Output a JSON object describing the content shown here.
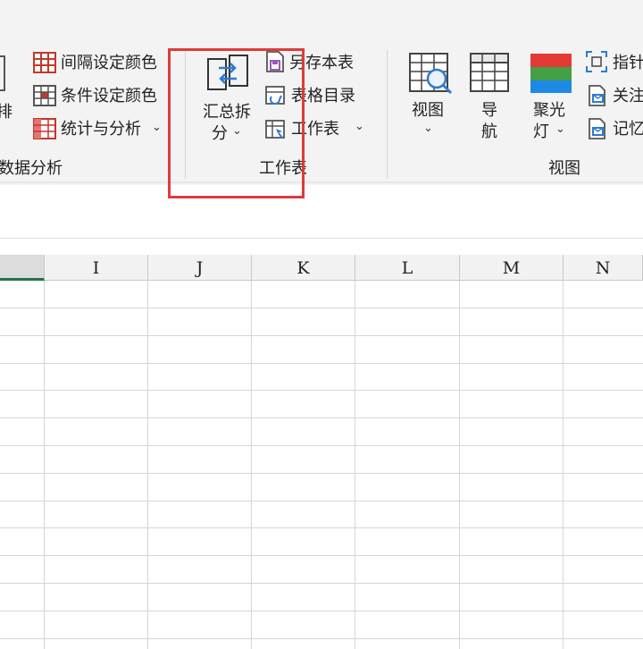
{
  "ribbon": {
    "left_partial_label": "排",
    "data_analysis_group": {
      "items": [
        {
          "label": "间隔设定颜色",
          "icon": "interval-color-icon"
        },
        {
          "label": "条件设定颜色",
          "icon": "condition-color-icon"
        },
        {
          "label": "统计与分析",
          "icon": "statistics-icon"
        }
      ],
      "group_label": "数据分析"
    },
    "worksheet_group": {
      "split_label_line1": "汇总拆",
      "split_label_line2": "分",
      "items": [
        {
          "label": "另存本表",
          "icon": "save-sheet-icon"
        },
        {
          "label": "表格目录",
          "icon": "table-directory-icon"
        },
        {
          "label": "工作表",
          "icon": "worksheet-icon"
        }
      ],
      "group_label": "工作表"
    },
    "view_group": {
      "view_label": "视图",
      "nav_label_line1": "导",
      "nav_label_line2": "航",
      "spotlight_label_line1": "聚光",
      "spotlight_label_line2": "灯",
      "items": [
        {
          "label": "指针",
          "icon": "pointer-icon"
        },
        {
          "label": "关注",
          "icon": "follow-icon"
        },
        {
          "label": "记忆",
          "icon": "memory-icon"
        }
      ],
      "group_label": "视图"
    }
  },
  "sheet": {
    "columns": [
      "I",
      "J",
      "K",
      "L",
      "M",
      "N"
    ],
    "highlight_color": "#e03a3a",
    "selection_color": "#217346"
  }
}
